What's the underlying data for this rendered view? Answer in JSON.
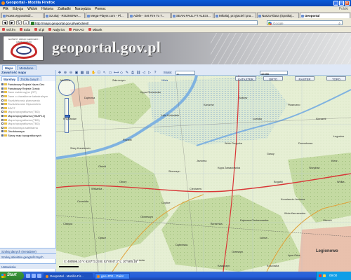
{
  "window": {
    "title": "Geoportal - Mozilla Firefox",
    "account": "Polski",
    "buttons": [
      "_",
      "□",
      "×"
    ]
  },
  "menu": [
    "Plik",
    "Edycja",
    "Widok",
    "Historia",
    "Zakładki",
    "Narzędzia",
    "Pomoc"
  ],
  "tabs": [
    {
      "label": "Nowa wypowiedź...",
      "active": false
    },
    {
      "label": "Szukaj - ROZMOWA...",
      "active": false
    },
    {
      "label": "Mega-Player.com - Pl...",
      "active": false
    },
    {
      "label": "Adele - Set Fire To T...",
      "active": false
    },
    {
      "label": "SEAN PAUL FT ALEXI...",
      "active": false
    },
    {
      "label": "Mikołaj, przyjaciel i pra...",
      "active": false
    },
    {
      "label": "Nasza-klasa (Spotkaj...",
      "active": false
    },
    {
      "label": "Geoportal",
      "active": true
    }
  ],
  "nav": {
    "url": "http://maps.geoportal.gov.pl/webclient/",
    "search_placeholder": "Google",
    "back": "◀",
    "forward": "▶"
  },
  "bookmarks": [
    "vsif.fm",
    "Edia",
    "sf.pl",
    "Najlyrics",
    "PEKAO",
    "Mbank"
  ],
  "banner": {
    "title": "geoportal.gov.pl",
    "logo_text": "GŁÓWNY URZĄD GEODEZJI I KARTOGRAFII"
  },
  "main_tabs": [
    {
      "label": "Mapa",
      "active": true
    },
    {
      "label": "Metadane",
      "active": false
    }
  ],
  "sidebar": {
    "header": "Zawartość mapy",
    "tabs": [
      {
        "label": "Warstwy",
        "active": true
      },
      {
        "label": "Źródła danych",
        "active": false
      }
    ],
    "tree": [
      {
        "label": "Państwowy Rejestr Nazw Geo",
        "checked": true,
        "dim": false,
        "indent": false
      },
      {
        "label": "Państwowy Rejestr Granic",
        "checked": true,
        "dim": false,
        "indent": false
      },
      {
        "label": "Dane ewidencyjne (GP)",
        "checked": false,
        "dim": true,
        "indent": false
      },
      {
        "label": "Dane o charakterze katastralnym",
        "checked": false,
        "dim": true,
        "indent": false
      },
      {
        "label": "Rozdzielczość planowania",
        "checked": false,
        "dim": true,
        "indent": false
      },
      {
        "label": "Rozdzielczość Hipsometria",
        "checked": false,
        "dim": true,
        "indent": false
      },
      {
        "label": "BDOT",
        "checked": false,
        "dim": true,
        "indent": false
      },
      {
        "label": "Mapa topograficzna (TBD)",
        "checked": false,
        "dim": true,
        "indent": false
      },
      {
        "label": "Mapa topograficzna (VMAPL2)",
        "checked": true,
        "dim": false,
        "indent": false
      },
      {
        "label": "Mapa topograficzna (TBD)",
        "checked": false,
        "dim": true,
        "indent": false
      },
      {
        "label": "Mapa topograficzna (TBD)",
        "checked": false,
        "dim": true,
        "indent": false
      },
      {
        "label": "Ortofotomapa satelitarna",
        "checked": false,
        "dim": true,
        "indent": false
      },
      {
        "label": "Ortofotomapa",
        "checked": true,
        "dim": false,
        "indent": false
      },
      {
        "label": "Skany map topograficznych",
        "checked": true,
        "dim": false,
        "indent": false
      }
    ],
    "bottom": [
      "Szukaj danych (metadane)",
      "Szukaj obiektów geograficznych",
      "Ustawienia"
    ]
  },
  "map": {
    "scale_label": "Skala:",
    "scale_value": "1:",
    "scale_number": "42456",
    "buttons": [
      "KATASTER",
      "ORTO",
      "RASTER",
      "TOPO"
    ],
    "coordinates": "X: 480596.10   Y: 624773.23   B: 52°06'47.2\"  L: 20°58'5.16\"",
    "zoom_level": 0.5,
    "labels": [
      "Dąbrowa",
      "Krzyżanów",
      "Kępa Okrzewska",
      "Łęki Kotowskie",
      "Rozalin",
      "Stary Konstancin",
      "Obórki",
      "Obory",
      "Czernidła",
      "Jeziorna",
      "Słomczyn",
      "Ciszyca",
      "Opacz",
      "Dąbrówka",
      "Brzezinka",
      "Okrzeszyn",
      "Wola Ciszycka",
      "Kępa Zawadowska",
      "Łoziska",
      "Gassy",
      "Cieciszew",
      "Dębówka",
      "Orzeszyn",
      "Bogatki",
      "Piaseczno",
      "Kierszek",
      "Drzembowa",
      "Strzyżów",
      "Kierz",
      "Wólka",
      "Konstancin-Jeziorna",
      "Łubna",
      "Kawęczyn",
      "Łysa Góra",
      "Otwock",
      "Dąbrowa Chotomowska",
      "Koszówka",
      "Wola Karczewska",
      "Legionowo",
      "Wiślanka",
      "Wisła",
      "Jabłonna",
      "Zakroczym",
      "Sołków",
      "Łegonice",
      "Karczew",
      "Chylice"
    ]
  },
  "taskbar": {
    "start": "Start",
    "tasks": [
      {
        "label": "Geoportal - Mozilla Fir...",
        "active": true
      },
      {
        "label": "geo.JPG - Paint",
        "active": false
      }
    ],
    "clock": "09:00"
  },
  "colors": {
    "map_background": "#e9f0d8",
    "forest": "#c6dba4",
    "water": "#7fb2e0",
    "road": "#d93636",
    "urban": "#e9b9a6",
    "titlebar": "#0a5bd8"
  },
  "icons": {
    "lock": "lock-icon",
    "search": "magnifier-icon",
    "zoom_in": "zoom-in-icon",
    "zoom_out": "zoom-out-icon",
    "pan": "hand-icon",
    "info": "info-icon",
    "measure": "ruler-icon",
    "print": "printer-icon"
  }
}
